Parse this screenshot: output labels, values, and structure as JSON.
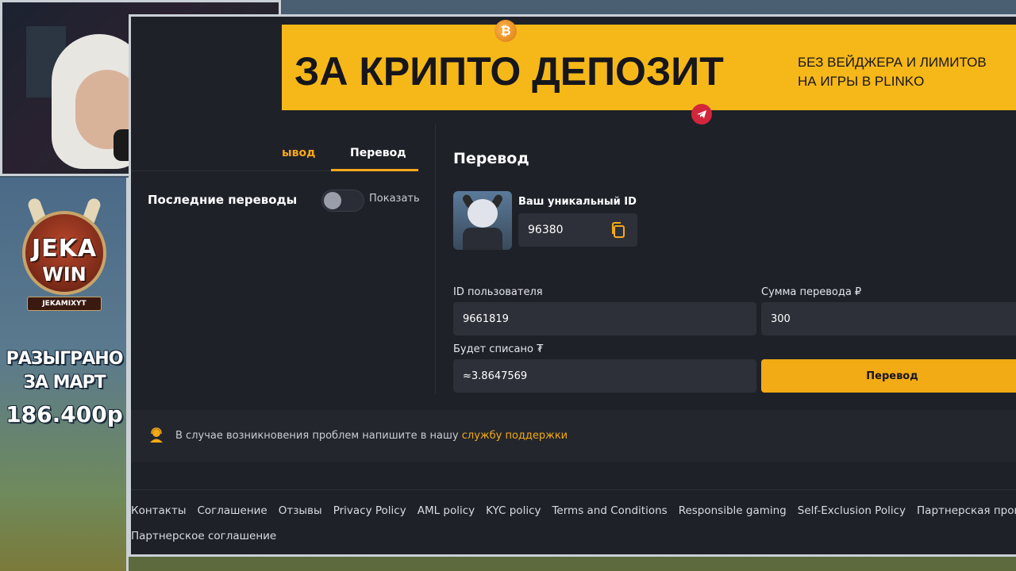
{
  "sidebar_overlay": {
    "logo_line1": "JEKA",
    "logo_line2": "WIN",
    "logo_tag": "JEKAMIXYT",
    "promo_line1": "РАЗЫГРАНО",
    "promo_line2": "ЗА МАРТ",
    "promo_amount": "186.400р"
  },
  "banner": {
    "headline": "ЗА КРИПТО ДЕПОЗИТ",
    "sub_line1": "БЕЗ ВЕЙДЖЕРА И ЛИМИТОВ",
    "sub_line2": "НА ИГРЫ В PLINKO",
    "coin_glyph": "₿"
  },
  "tabs": {
    "withdraw": "ывод",
    "transfer": "Перевод"
  },
  "recent": {
    "label": "Последние переводы",
    "toggle_label": "Показать",
    "toggle_on": false
  },
  "transfer_panel": {
    "title": "Перевод",
    "unique_id_label": "Ваш уникальный ID",
    "unique_id_value": "96380",
    "user_id_label": "ID пользователя",
    "user_id_value": "9661819",
    "amount_label": "Сумма перевода ₽",
    "amount_value": "300",
    "debit_label": "Будет списано ₮",
    "debit_value": "≈3.8647569",
    "submit_label": "Перевод"
  },
  "support": {
    "text": "В случае возникновения проблем напишите в нашу ",
    "link": "службу поддержки"
  },
  "footer": {
    "links": [
      "Контакты",
      "Соглашение",
      "Отзывы",
      "Privacy Policy",
      "AML policy",
      "KYC policy",
      "Terms and Conditions",
      "Responsible gaming",
      "Self-Exclusion Policy",
      "Партнерская программа"
    ],
    "second_row": "Партнерское соглашение"
  },
  "colors": {
    "accent": "#f2aa15",
    "banner_bg": "#f6b818",
    "page_bg": "#1f2129",
    "field_bg": "#2e3039"
  }
}
